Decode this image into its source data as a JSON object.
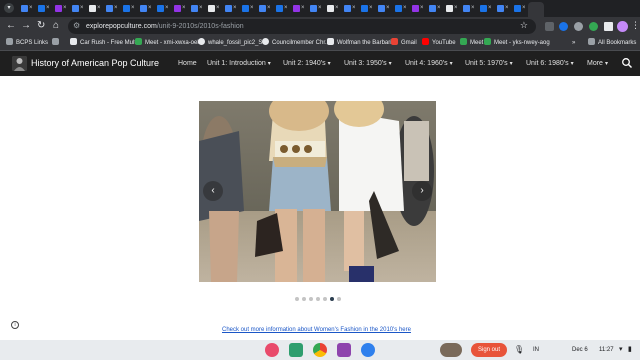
{
  "browser": {
    "url_domain": "explorepopculture.com",
    "url_path": "/unit-9-2010s/2010s-fashion",
    "tab_count_visible": 31
  },
  "bookmarks": [
    {
      "label": "BCPS Links",
      "icon": "folder-icon",
      "color": "#9aa0a6"
    },
    {
      "label": "",
      "icon": "grid-icon",
      "color": "#9aa0a6"
    },
    {
      "label": "Car Rush - Free Mult...",
      "icon": "x-logo-icon",
      "color": "#e8eaed"
    },
    {
      "label": "Meet - xmi-xwxa-oek",
      "icon": "meet-icon",
      "color": "#34a853"
    },
    {
      "label": "whale_fossil_pic2_S...",
      "icon": "globe-icon",
      "color": "#e8eaed"
    },
    {
      "label": "Councilmember Chr...",
      "icon": "globe-icon",
      "color": "#e8eaed"
    },
    {
      "label": "Wolfman the Barbari...",
      "icon": "x-logo-icon",
      "color": "#e8eaed"
    },
    {
      "label": "Gmail",
      "icon": "gmail-icon",
      "color": "#ea4335"
    },
    {
      "label": "YouTube",
      "icon": "youtube-icon",
      "color": "#ff0000"
    },
    {
      "label": "Meet",
      "icon": "meet-icon",
      "color": "#34a853"
    },
    {
      "label": "Meet - yks-nwey-aog",
      "icon": "meet-icon",
      "color": "#34a853"
    },
    {
      "label": "All Bookmarks",
      "icon": "folder-icon",
      "color": "#9aa0a6"
    }
  ],
  "site": {
    "title": "History of American Pop Culture",
    "nav": [
      {
        "label": "Home",
        "dropdown": false
      },
      {
        "label": "Unit 1: Introduction",
        "dropdown": true
      },
      {
        "label": "Unit 2: 1940's",
        "dropdown": true
      },
      {
        "label": "Unit 3: 1950's",
        "dropdown": true
      },
      {
        "label": "Unit 4: 1960's",
        "dropdown": true
      },
      {
        "label": "Unit 5: 1970's",
        "dropdown": true
      },
      {
        "label": "Unit 6: 1980's",
        "dropdown": true
      },
      {
        "label": "More",
        "dropdown": true
      }
    ]
  },
  "carousel": {
    "prev": "‹",
    "next": "›",
    "slide_count": 7,
    "active_index": 5
  },
  "link_text": "Check out more information about Women's Fashion in the 2010's here",
  "shelf": {
    "signout": "Sign out",
    "lang": "IN",
    "date": "Dec 6",
    "time": "11:27"
  },
  "colors": {
    "site_nav_bg": "#1f1f1f",
    "link": "#1a56c7",
    "dot_active": "#2c3e50",
    "signout": "#e8543a"
  }
}
